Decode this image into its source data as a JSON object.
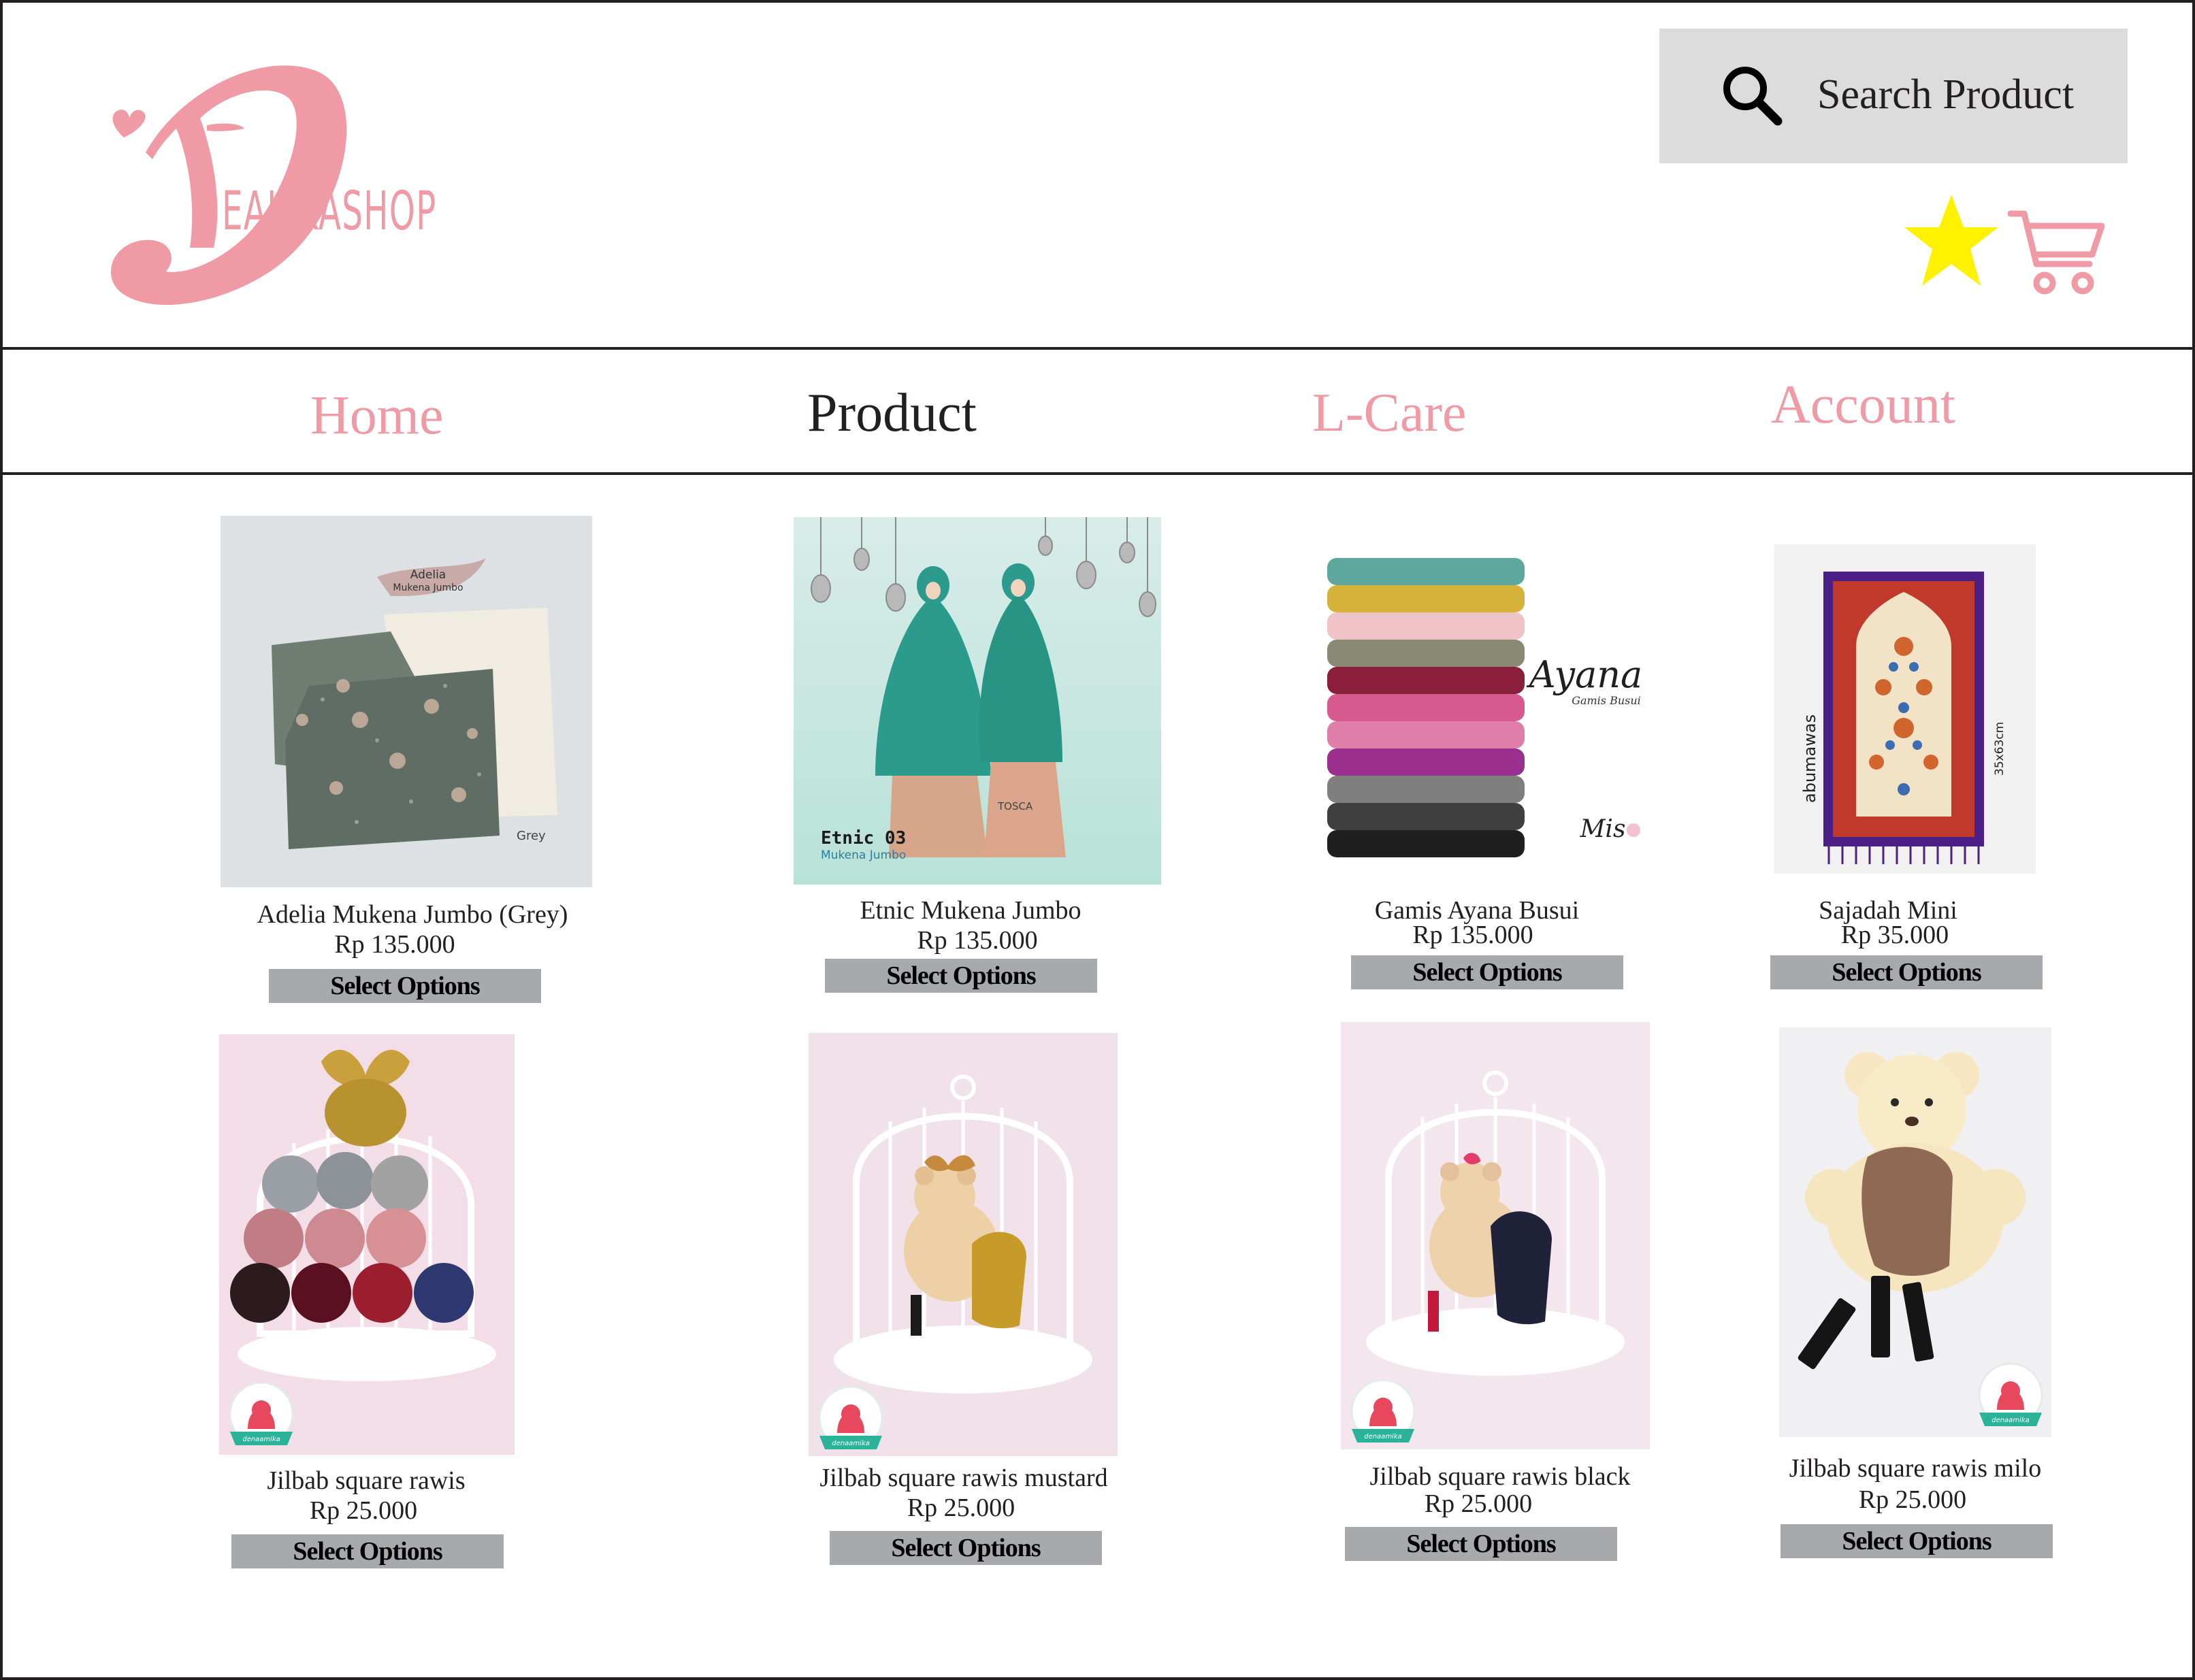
{
  "brand": {
    "logo_text": "EALIKASHOP",
    "accent_color": "#ef9aa4"
  },
  "search": {
    "label": "Search Product",
    "icon": "search-icon"
  },
  "header_icons": {
    "favorites_icon": "star-icon",
    "favorites_color": "#fff200",
    "cart_icon": "cart-icon"
  },
  "nav": {
    "items": [
      {
        "label": "Home",
        "active": false,
        "color": "#ef9aa4"
      },
      {
        "label": "Product",
        "active": true,
        "color": "#231f20"
      },
      {
        "label": "L-Care",
        "active": false,
        "color": "#ef9aa4"
      },
      {
        "label": "Account",
        "active": false,
        "color": "#ef9aa4"
      }
    ]
  },
  "products": [
    {
      "name": "Adelia Mukena Jumbo (Grey)",
      "price": "Rp 135.000",
      "button": "Select Options",
      "image_text": [
        "Adelia",
        "Mukena Jumbo",
        "Grey"
      ]
    },
    {
      "name": "Etnic Mukena Jumbo",
      "price": "Rp 135.000",
      "button": "Select Options",
      "image_text": [
        "Etnic 03",
        "Mukena Jumbo",
        "TOSCA"
      ]
    },
    {
      "name": "Gamis Ayana Busui",
      "price": "Rp 135.000",
      "button": "Select Options",
      "image_text": [
        "Ayana",
        "Gamis Busui",
        "Mis"
      ]
    },
    {
      "name": "Sajadah Mini",
      "price": "Rp 35.000",
      "button": "Select Options",
      "image_text": [
        "abumawas",
        "35x63cm"
      ]
    },
    {
      "name": "Jilbab square rawis",
      "price": "Rp 25.000",
      "button": "Select Options",
      "image_text": [
        "denaamika"
      ]
    },
    {
      "name": "Jilbab square rawis mustard",
      "price": "Rp 25.000",
      "button": "Select Options",
      "image_text": [
        "denaamika"
      ]
    },
    {
      "name": "Jilbab square rawis black",
      "price": "Rp 25.000",
      "button": "Select Options",
      "image_text": [
        "denaamika"
      ]
    },
    {
      "name": "Jilbab square rawis milo",
      "price": "Rp 25.000",
      "button": "Select Options",
      "image_text": [
        "denaamika"
      ]
    }
  ]
}
